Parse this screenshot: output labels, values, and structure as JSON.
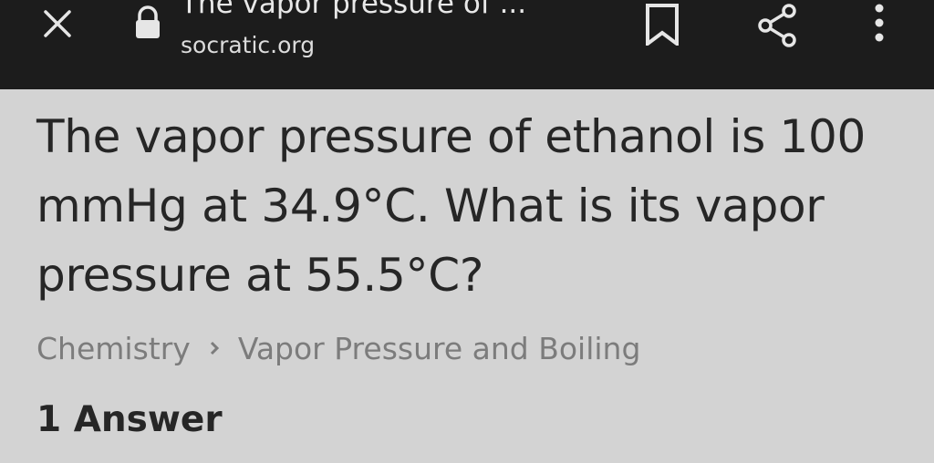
{
  "browser": {
    "tab_title": "The vapor pressure of ...",
    "url": "socratic.org",
    "icons": {
      "close": "close-icon",
      "secure": "lock-icon",
      "bookmark": "bookmark-icon",
      "share": "share-icon",
      "menu": "more-vertical-icon"
    }
  },
  "question": {
    "text": "The vapor pressure of ethanol is 100 mmHg at 34.9°C. What is its vapor pressure at 55.5°C?"
  },
  "breadcrumb": {
    "subject": "Chemistry",
    "topic": "Vapor Pressure and Boiling"
  },
  "answers": {
    "count_label": "1 Answer"
  },
  "colors": {
    "toolbar_bg": "#1c1c1c",
    "page_bg": "#d3d3d3",
    "text": "#262626",
    "muted_text": "#7c7c7c"
  }
}
